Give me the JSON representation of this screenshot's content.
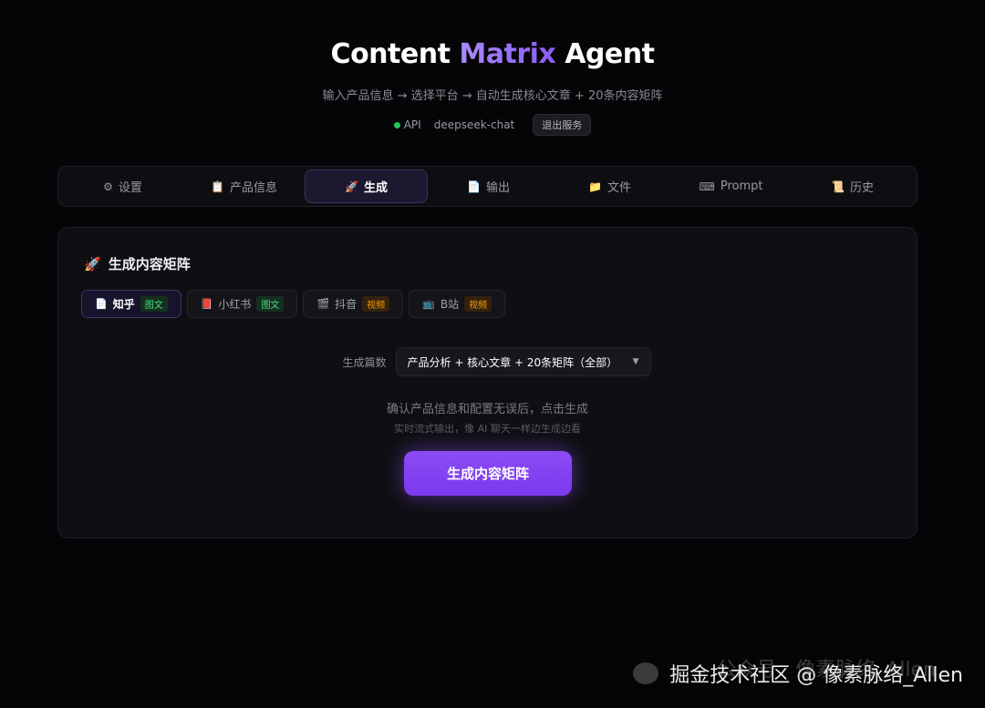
{
  "header": {
    "title_prefix": "Content ",
    "title_accent": "Matrix",
    "title_suffix": " Agent",
    "subtitle": "输入产品信息 → 选择平台 → 自动生成核心文章 + 20条内容矩阵",
    "api_label": "API",
    "model": "deepseek-chat",
    "logout_label": "退出服务",
    "status_color": "#22c55e"
  },
  "tabs": [
    {
      "icon": "⚙",
      "label": "设置"
    },
    {
      "icon": "📋",
      "label": "产品信息"
    },
    {
      "icon": "🚀",
      "label": "生成"
    },
    {
      "icon": "📄",
      "label": "输出"
    },
    {
      "icon": "📁",
      "label": "文件"
    },
    {
      "icon": "⌨",
      "label": "Prompt"
    },
    {
      "icon": "📜",
      "label": "历史"
    }
  ],
  "panel": {
    "icon": "🚀",
    "title": "生成内容矩阵",
    "platforms": [
      {
        "icon": "📄",
        "label": "知乎",
        "badge": "图文"
      },
      {
        "icon": "📕",
        "label": "小红书",
        "badge": "图文"
      },
      {
        "icon": "🎬",
        "label": "抖音",
        "badge": "视频"
      },
      {
        "icon": "📺",
        "label": "B站",
        "badge": "视频"
      }
    ],
    "count_label": "生成篇数",
    "count_value": "产品分析 + 核心文章 + 20条矩阵（全部）",
    "confirm_text": "确认产品信息和配置无误后，点击生成",
    "hint_text": "实时流式输出，像 AI 聊天一样边生成边看",
    "generate_label": "生成内容矩阵"
  },
  "watermark": {
    "ghost": "公众号 · 像素脉络_Allen",
    "text": "掘金技术社区 @ 像素脉络_Allen"
  },
  "colors": {
    "accent": "#8b5cf6",
    "button": "#7c3aed",
    "badge_green": "#4ade80",
    "badge_orange": "#f59e0b"
  }
}
